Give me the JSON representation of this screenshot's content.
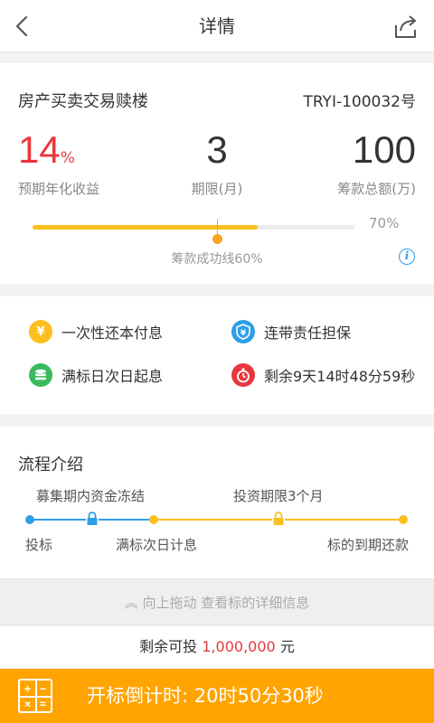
{
  "header": {
    "title": "详情",
    "back_icon": "chevron-left-icon",
    "share_icon": "share-icon"
  },
  "product": {
    "name": "房产买卖交易赎楼",
    "code": "TRYI-100032号"
  },
  "stats": {
    "rate_value": "14",
    "rate_unit": "%",
    "rate_label": "预期年化收益",
    "term_value": "3",
    "term_label": "期限(月)",
    "amount_value": "100",
    "amount_label": "筹款总额(万)"
  },
  "progress": {
    "percent": 70,
    "percent_text": "70%",
    "success_line_percent": 60,
    "success_text": "筹款成功线60%",
    "fill_color": "#fbbf1f",
    "marker_color": "#f6a622"
  },
  "features": [
    {
      "label": "一次性还本付息",
      "icon": "coin-hand-icon",
      "color": "#fbbf1f"
    },
    {
      "label": "连带责任担保",
      "icon": "yuan-shield-icon",
      "color": "#2f9ee8"
    },
    {
      "label": "满标日次日起息",
      "icon": "stacked-coins-icon",
      "color": "#3cb95f"
    },
    {
      "label": "剩余9天14时48分59秒",
      "icon": "stopwatch-icon",
      "color": "#e8383d"
    }
  ],
  "process": {
    "title": "流程介绍",
    "phase1_label": "募集期内资金冻结",
    "phase2_label": "投资期限3个月",
    "step1": "投标",
    "step2": "满标次日计息",
    "step3": "标的到期还款",
    "blue": "#2f9ee8",
    "yellow": "#fbbf1f"
  },
  "pull_hint": "向上拖动  查看标的详细信息",
  "remain": {
    "prefix": "剩余可投",
    "amount": "1,000,000",
    "unit": "元"
  },
  "bottom": {
    "calc_icon": "calculator-icon",
    "countdown": "开标倒计时:  20时50分30秒",
    "color": "#ffa400"
  }
}
